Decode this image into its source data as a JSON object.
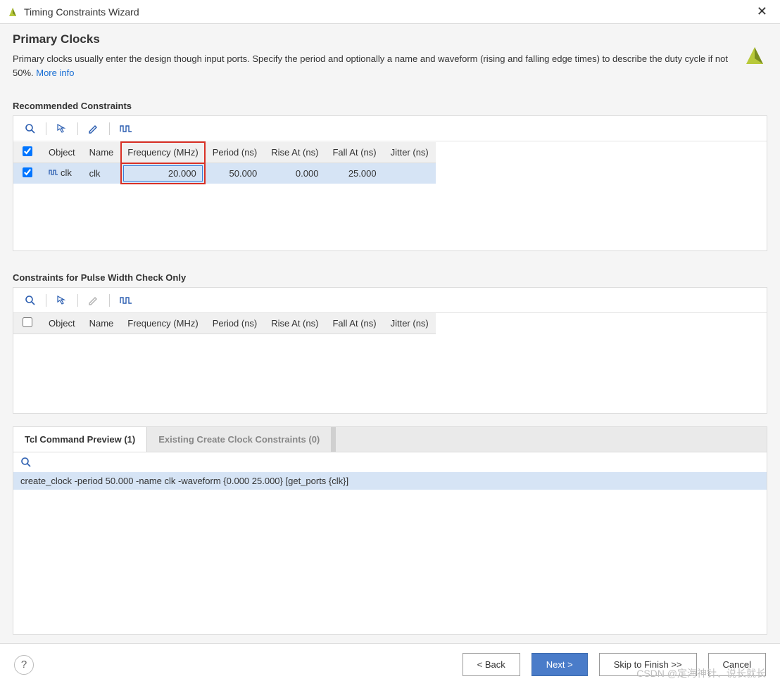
{
  "window": {
    "title": "Timing Constraints Wizard"
  },
  "header": {
    "title": "Primary Clocks",
    "desc_prefix": "Primary clocks usually enter the design though input ports. Specify the period and optionally a name and waveform (rising and falling edge times) to describe the duty cycle if not 50%. ",
    "more_info": "More info"
  },
  "sections": {
    "recommended": {
      "title": "Recommended Constraints",
      "columns": {
        "object": "Object",
        "name": "Name",
        "frequency": "Frequency (MHz)",
        "period": "Period (ns)",
        "rise_at": "Rise At (ns)",
        "fall_at": "Fall At (ns)",
        "jitter": "Jitter (ns)"
      },
      "rows": [
        {
          "checked": true,
          "object": "clk",
          "name": "clk",
          "frequency": "20.000",
          "period": "50.000",
          "rise_at": "0.000",
          "fall_at": "25.000",
          "jitter": ""
        }
      ]
    },
    "pulsewidth": {
      "title": "Constraints for Pulse Width Check Only",
      "columns": {
        "object": "Object",
        "name": "Name",
        "frequency": "Frequency (MHz)",
        "period": "Period (ns)",
        "rise_at": "Rise At (ns)",
        "fall_at": "Fall At (ns)",
        "jitter": "Jitter (ns)"
      }
    }
  },
  "tabs": {
    "preview": "Tcl Command Preview (1)",
    "existing": "Existing Create Clock Constraints (0)",
    "command": "create_clock -period 50.000 -name clk -waveform {0.000 25.000} [get_ports {clk}]"
  },
  "footer": {
    "help": "?",
    "back": "< Back",
    "next": "Next >",
    "skip": "Skip to Finish >>",
    "cancel": "Cancel"
  },
  "watermark": "CSDN @定海神针、说长就长"
}
